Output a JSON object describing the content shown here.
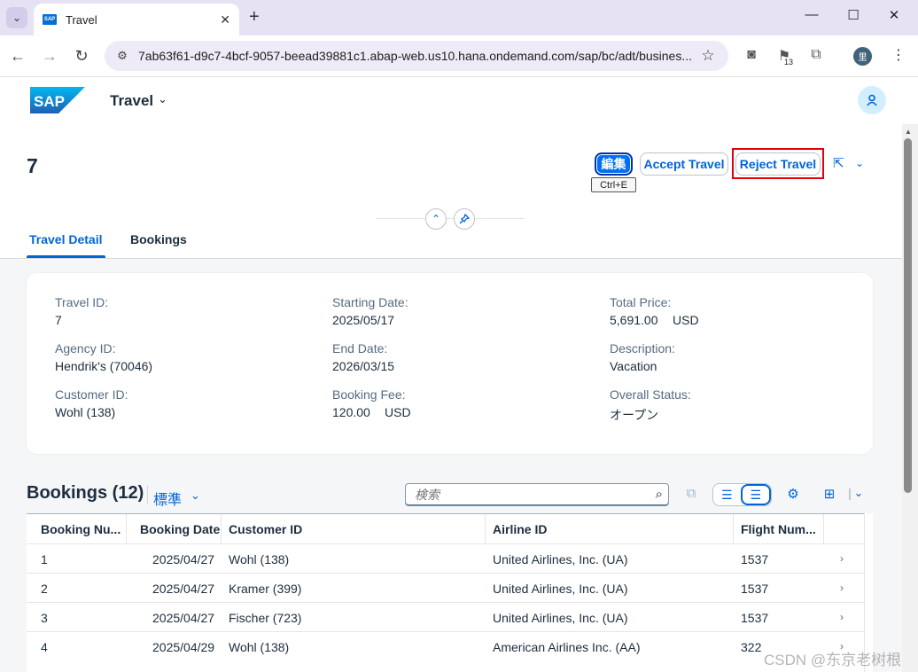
{
  "browser": {
    "tab_title": "Travel",
    "url": "7ab63f61-d9c7-4bcf-9057-beead39881c1.abap-web.us10.hana.ondemand.com/sap/bc/adt/busines...",
    "notification_count": "13",
    "profile_initial": "里"
  },
  "shell": {
    "logo_text": "SAP",
    "app_title": "Travel"
  },
  "header": {
    "object_title": "7",
    "edit_label": "編集",
    "edit_shortcut": "Ctrl+E",
    "accept_label": "Accept Travel",
    "reject_label": "Reject Travel",
    "tabs": [
      {
        "label": "Travel Detail"
      },
      {
        "label": "Bookings"
      }
    ]
  },
  "details": {
    "travel_id_label": "Travel ID:",
    "travel_id": "7",
    "agency_id_label": "Agency ID:",
    "agency_id": "Hendrik's (70046)",
    "customer_id_label": "Customer ID:",
    "customer_id": "Wohl (138)",
    "starting_date_label": "Starting Date:",
    "starting_date": "2025/05/17",
    "end_date_label": "End Date:",
    "end_date": "2026/03/15",
    "booking_fee_label": "Booking Fee:",
    "booking_fee": "120.00",
    "booking_fee_currency": "USD",
    "total_price_label": "Total Price:",
    "total_price": "5,691.00",
    "total_price_currency": "USD",
    "description_label": "Description:",
    "description": "Vacation",
    "overall_status_label": "Overall Status:",
    "overall_status": "オープン"
  },
  "bookings": {
    "title": "Bookings (12)",
    "variant": "標準",
    "search_placeholder": "検索",
    "columns": [
      "Booking Nu...",
      "Booking Date",
      "Customer ID",
      "Airline ID",
      "Flight Num..."
    ],
    "rows": [
      {
        "number": "1",
        "date": "2025/04/27",
        "customer": "Wohl (138)",
        "airline": "United Airlines, Inc. (UA)",
        "flight": "1537"
      },
      {
        "number": "2",
        "date": "2025/04/27",
        "customer": "Kramer (399)",
        "airline": "United Airlines, Inc. (UA)",
        "flight": "1537"
      },
      {
        "number": "3",
        "date": "2025/04/27",
        "customer": "Fischer (723)",
        "airline": "United Airlines, Inc. (UA)",
        "flight": "1537"
      },
      {
        "number": "4",
        "date": "2025/04/29",
        "customer": "Wohl (138)",
        "airline": "American Airlines Inc. (AA)",
        "flight": "322"
      }
    ]
  },
  "watermark": "CSDN @东京老树根",
  "colors": {
    "accent": "#0064d9",
    "emphasized_button": "#0070f2",
    "highlight_box": "#e3000f"
  }
}
